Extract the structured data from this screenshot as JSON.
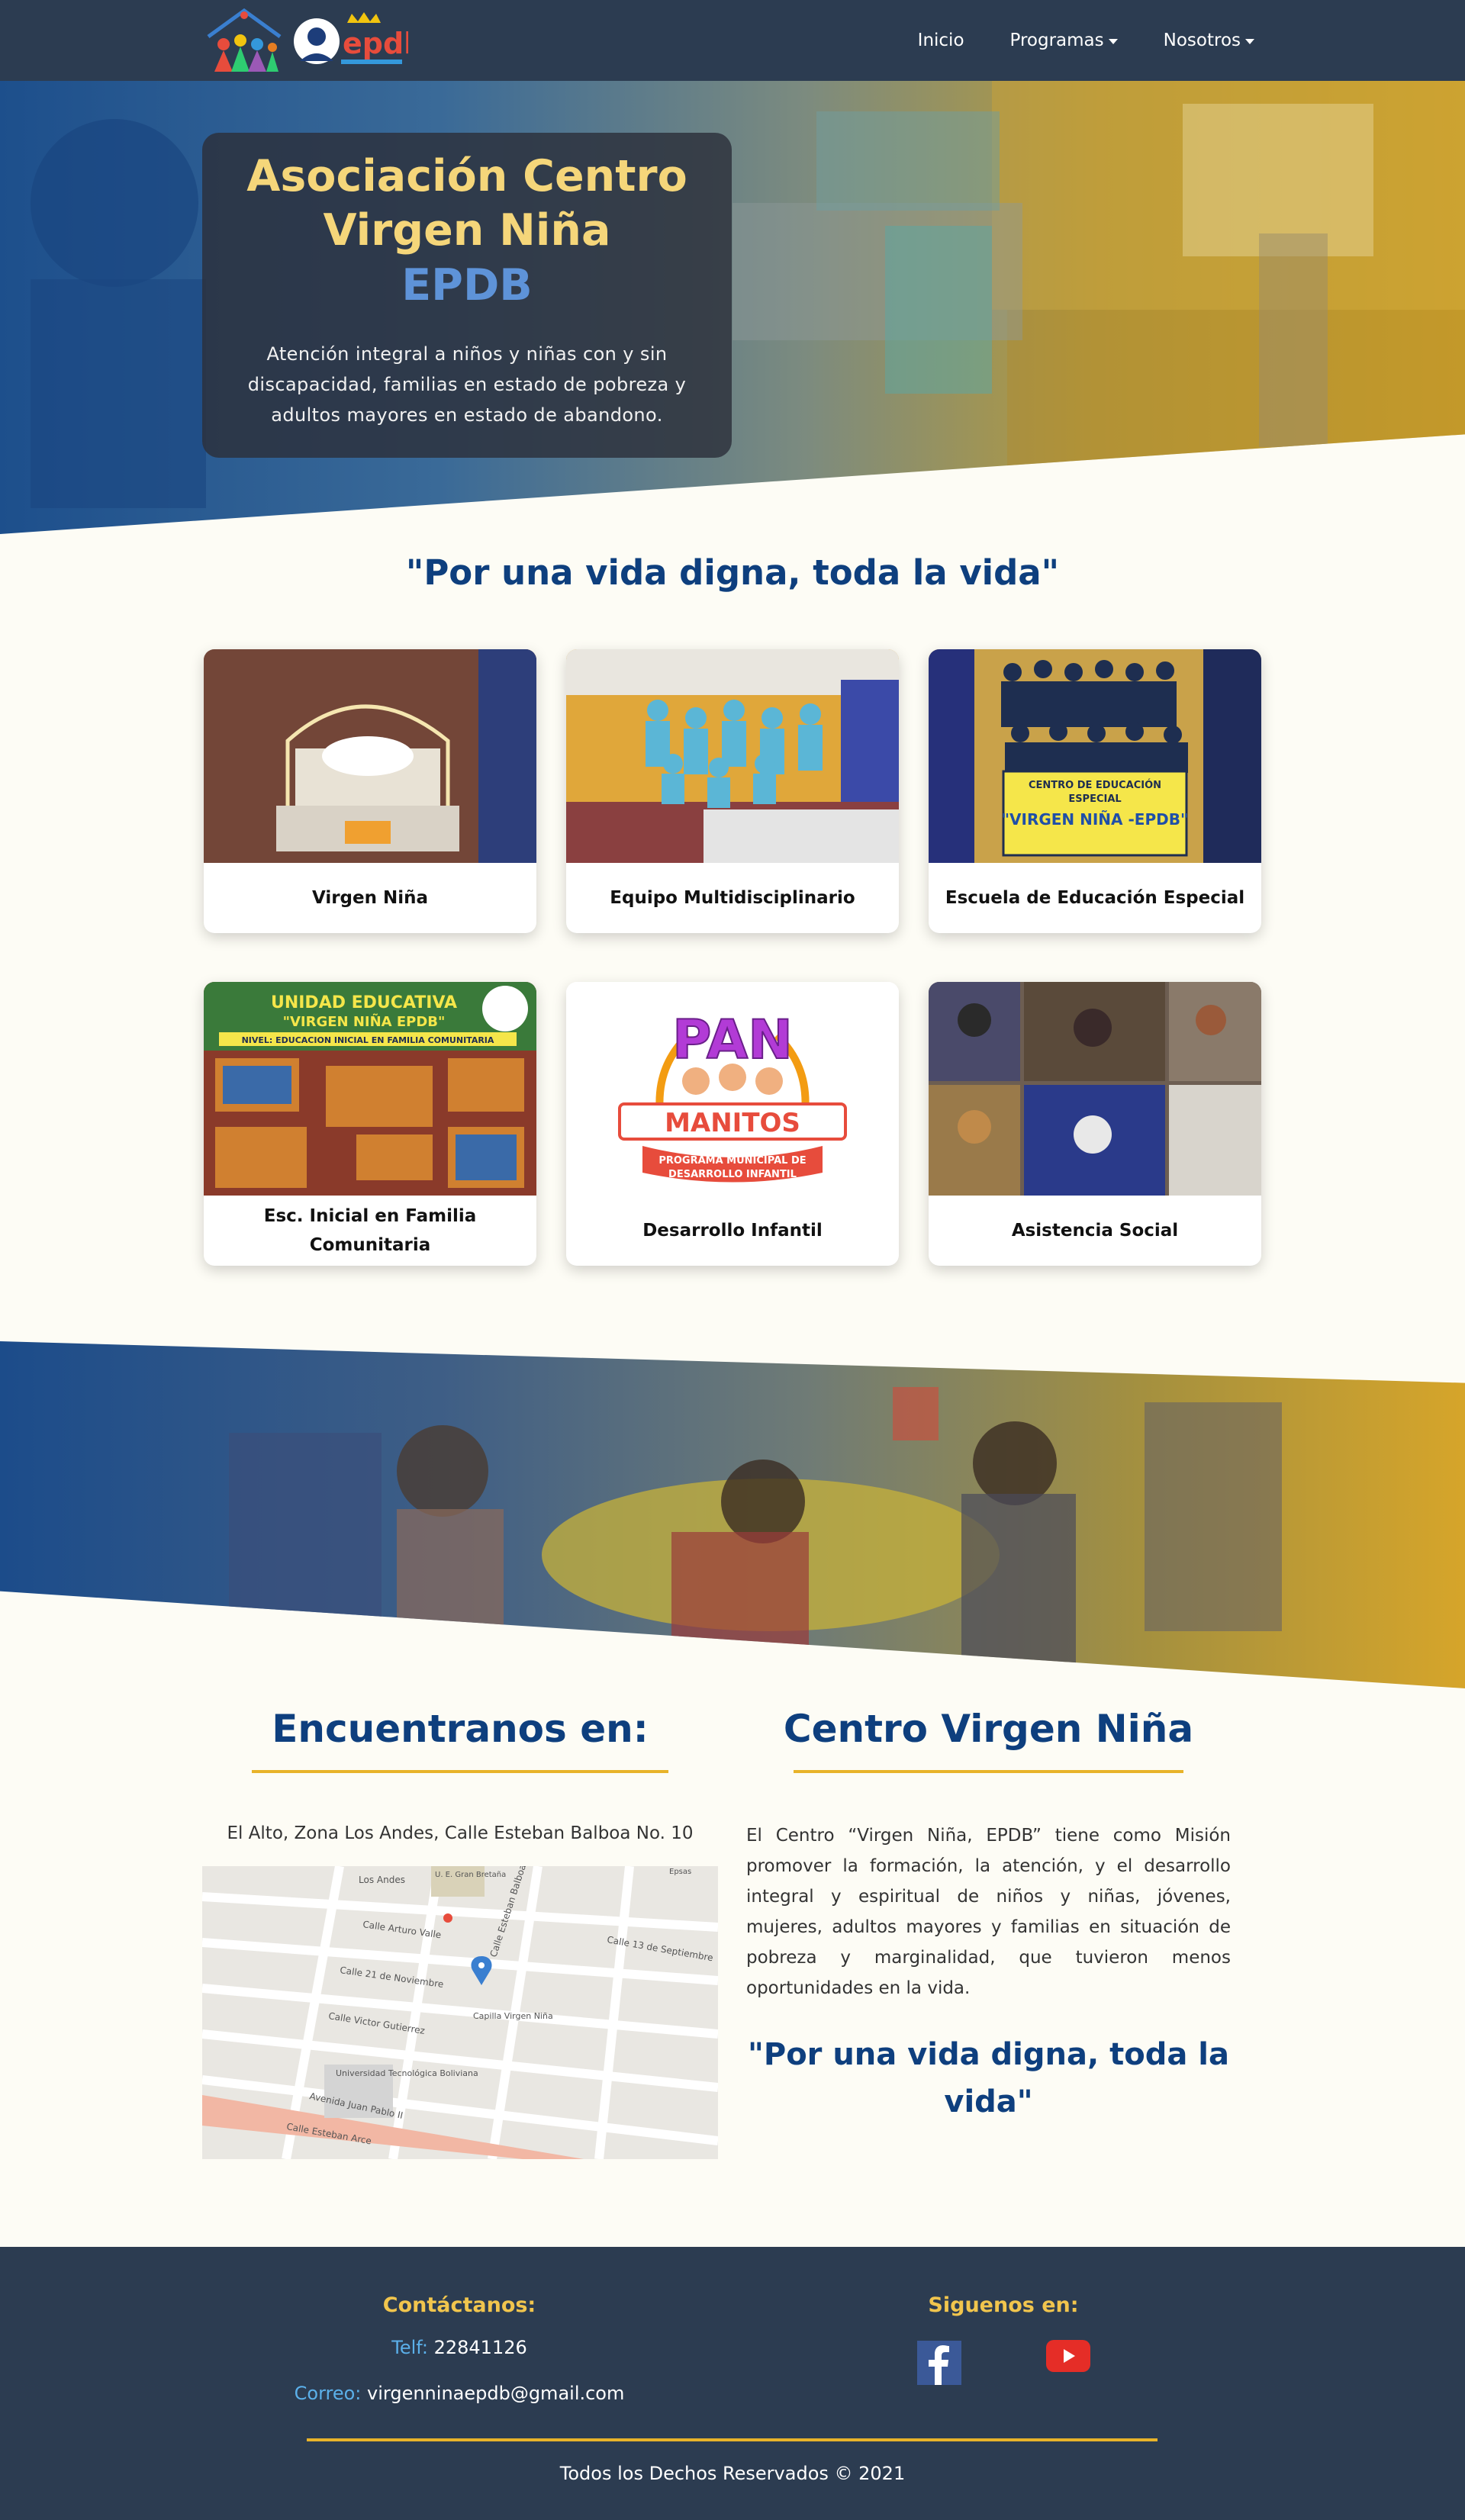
{
  "nav": {
    "items": [
      {
        "label": "Inicio"
      },
      {
        "label": "Programas"
      },
      {
        "label": "Nosotros"
      }
    ]
  },
  "logo": {
    "text": "epdb"
  },
  "hero": {
    "title": "Asociación Centro Virgen Niña",
    "subtitle": "EPDB",
    "description": "Atención integral a niños y niñas con y sin discapacidad, familias en estado de pobreza y adultos mayores en estado de abandono."
  },
  "motto": "\"Por una vida digna, toda la vida\"",
  "programs": [
    {
      "title": "Virgen Niña"
    },
    {
      "title": "Equipo Multidisciplinario"
    },
    {
      "title": "Escuela de Educación Especial"
    },
    {
      "title": "Esc. Inicial en Familia Comunitaria"
    },
    {
      "title": "Desarrollo Infantil"
    },
    {
      "title": "Asistencia Social"
    }
  ],
  "card_images": {
    "sign_school": [
      "CENTRO DE EDUCACIÓN",
      "ESPECIAL",
      "\"VIRGEN NIÑA -EPDB\""
    ],
    "sign_inicial": [
      "UNIDAD EDUCATIVA",
      "\"VIRGEN NIÑA EPDB\"",
      "NIVEL: EDUCACION INICIAL EN FAMILIA COMUNITARIA"
    ],
    "panmanitos": {
      "line1": "PAN",
      "line2": "MANITOS",
      "caption1": "PROGRAMA MUNICIPAL DE",
      "caption2": "DESARROLLO INFANTIL"
    }
  },
  "location": {
    "heading": "Encuentranos en:",
    "address": "El Alto, Zona Los Andes, Calle Esteban Balboa No. 10",
    "map_labels": {
      "area": "Los Andes",
      "school": "U. E. Gran Bretaña",
      "street1": "Calle Arturo Valle",
      "street2": "Calle 21 de Noviembre",
      "street3": "Calle Victor Gutierrez",
      "street4": "Calle 13 de Septiembre",
      "street5": "Calle Esteban Balboa",
      "street6": "Avenida Juan Pablo II",
      "street7": "Calle Esteban Arce",
      "poi1": "Capilla Virgen Niña",
      "poi2": "Universidad Tecnológica Boliviana",
      "corner": "Epsas"
    }
  },
  "about": {
    "heading": "Centro Virgen Niña",
    "description": "El Centro “Virgen Niña, EPDB” tiene como Misión promover la formación, la atención, y el desarrollo integral y espiritual de niños y niñas, jóvenes, mujeres, adultos mayores y familias en situación de pobreza y marginalidad, que tuvieron menos oportunidades en la vida.",
    "motto": "\"Por una vida digna, toda la vida\""
  },
  "footer": {
    "contact_heading": "Contáctanos:",
    "phone_label": "Telf:",
    "phone": "22841126",
    "email_label": "Correo:",
    "email": "virgenninaepdb@gmail.com",
    "social_heading": "Siguenos en:",
    "copyright": "Todos los Dechos Reservados © 2021"
  },
  "colors": {
    "navbar": "#2c3c51",
    "heading_blue": "#0e3f7e",
    "accent_gold": "#e8b32a",
    "hero_title": "#f5d67a",
    "hero_sub": "#5e93d8",
    "background": "#fdfcf5"
  },
  "icons": [
    "facebook-icon",
    "youtube-icon",
    "map-pin-icon",
    "caret-down-icon"
  ]
}
